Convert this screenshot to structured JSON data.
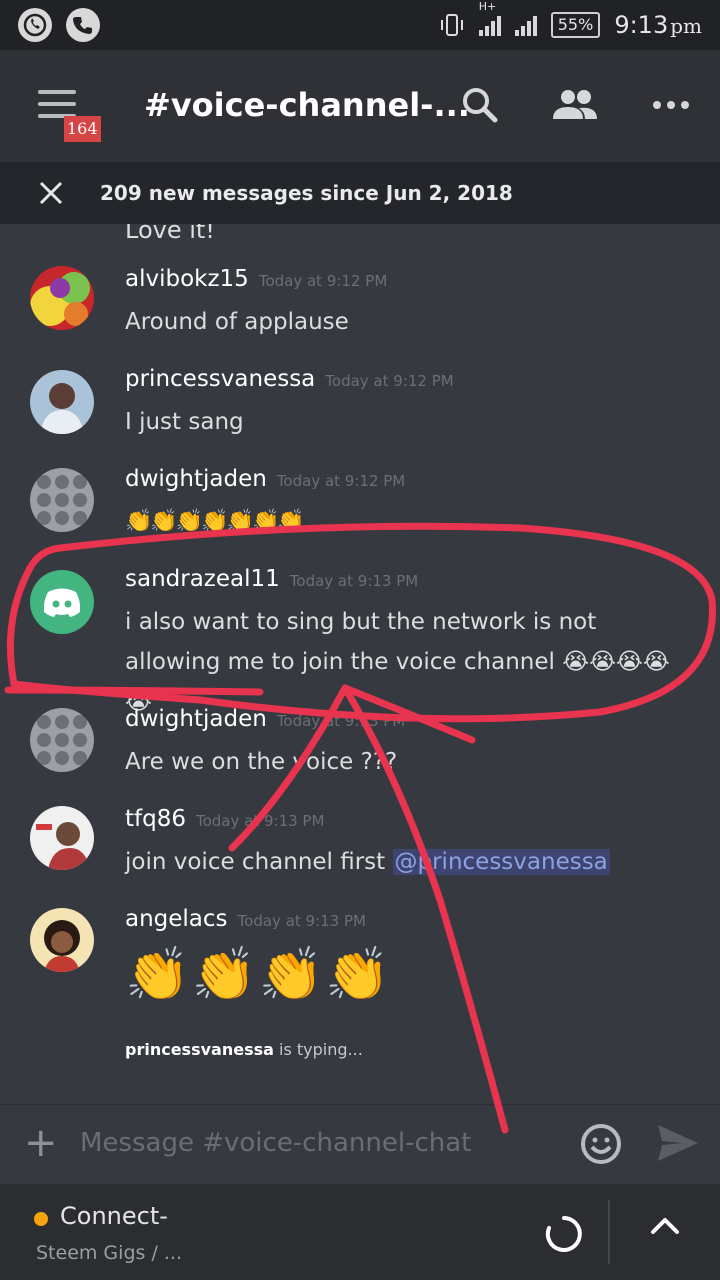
{
  "statusbar": {
    "net_label": "H+",
    "battery": "55%",
    "time": "9:13",
    "ampm": "pm"
  },
  "header": {
    "badge_count": "164",
    "channel_title": "#voice-channel-...",
    "icons": [
      "menu-icon",
      "search-icon",
      "members-icon",
      "more-icon"
    ]
  },
  "new_messages_bar": {
    "text": "209 new messages since Jun 2, 2018"
  },
  "messages": {
    "partial_text": "Love it!",
    "items": [
      {
        "username": "alvibokz15",
        "timestamp": "Today at 9:12 PM",
        "text": "Around of applause"
      },
      {
        "username": "princessvanessa",
        "timestamp": "Today at 9:12 PM",
        "text": "I just sang"
      },
      {
        "username": "dwightjaden",
        "timestamp": "Today at 9:12 PM",
        "text": "👏👏👏👏👏👏👏"
      },
      {
        "username": "sandrazeal11",
        "timestamp": "Today at 9:13 PM",
        "text": "i also want to sing but the network is not allowing me to join the voice channel 😭😭😭😭😭"
      },
      {
        "username": "dwightjaden",
        "timestamp": "Today at 9:13 PM",
        "text": "Are we on the voice ???"
      },
      {
        "username": "tfq86",
        "timestamp": "Today at 9:13 PM",
        "text": "join voice channel first ",
        "mention": "@princessvanessa"
      },
      {
        "username": "angelacs",
        "timestamp": "Today at 9:13 PM",
        "text": "👏👏👏👏"
      }
    ]
  },
  "typing": {
    "user": "princessvanessa",
    "suffix": " is typing..."
  },
  "composer": {
    "placeholder": "Message #voice-channel-chat"
  },
  "voice": {
    "status": "Connect-",
    "server": "Steem Gigs / ..."
  },
  "colors": {
    "annotation": "#e8344e",
    "status_dot": "#f6a40e",
    "discord_green": "#43b581",
    "mention_bg": "#3d4470"
  }
}
